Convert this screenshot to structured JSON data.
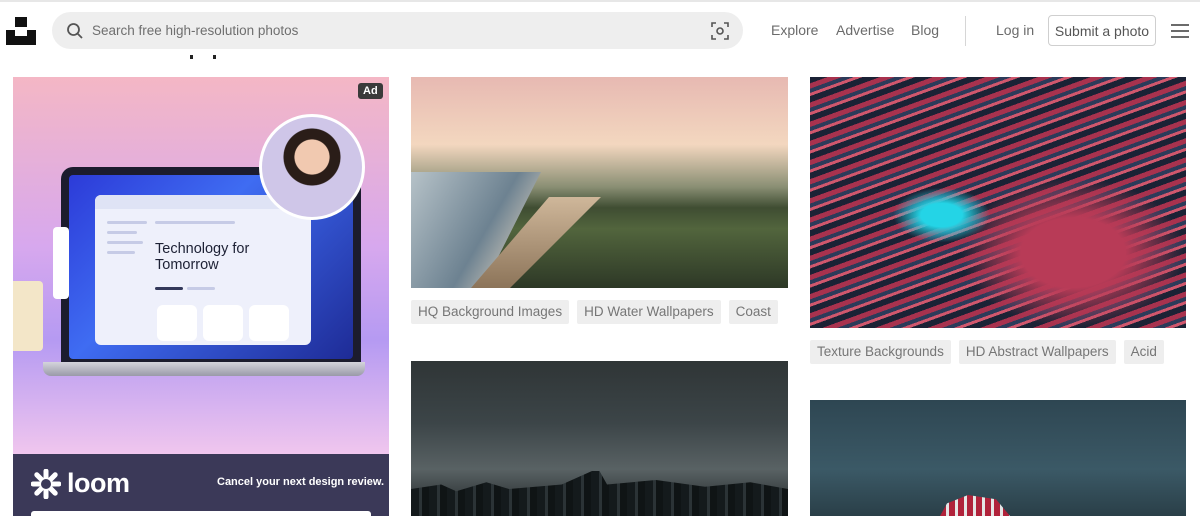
{
  "header": {
    "search_placeholder": "Search free high-resolution photos",
    "nav": [
      "Explore",
      "Advertise",
      "Blog"
    ],
    "login_label": "Log in",
    "submit_label": "Submit a photo",
    "icons": {
      "logo": "unsplash-logo-icon",
      "search": "search-icon",
      "visual_search": "visual-search-icon",
      "menu": "hamburger-menu-icon"
    }
  },
  "ad": {
    "badge": "Ad",
    "screen_text": "Technology for Tomorrow",
    "brand": "loom",
    "tagline": "Cancel your next design review.",
    "brand_color": "#3b3958"
  },
  "photos": [
    {
      "tags": [
        "HQ Background Images",
        "HD Water Wallpapers",
        "Coast"
      ]
    },
    {
      "tags": [
        "Texture Backgrounds",
        "HD Abstract Wallpapers",
        "Acid"
      ]
    }
  ],
  "colors": {
    "tag_bg": "#eeeeee",
    "tag_text": "#767676",
    "nav_text": "#6b6b6b"
  }
}
